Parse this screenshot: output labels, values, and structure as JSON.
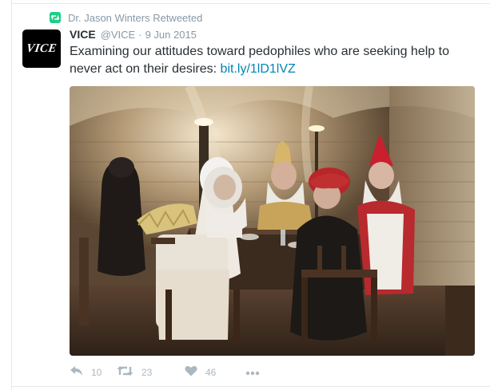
{
  "retweet_context": {
    "text": "Dr. Jason Winters Retweeted",
    "icon": "retweet-icon",
    "color": "#19cf86"
  },
  "tweet": {
    "avatar_text": "VICE",
    "fullname": "VICE",
    "username": "@VICE",
    "separator": "·",
    "timestamp": "9 Jun 2015",
    "text": "Examining our attitudes toward pedophiles who are seeking help to never act on their desires: ",
    "link": "bit.ly/1lD1lVZ",
    "link_color": "#0084b4",
    "media_icon": "photo-vaulted-cellar-costumed-people-at-table"
  },
  "actions": {
    "reply": {
      "icon": "reply-icon",
      "count": "10"
    },
    "retweet": {
      "icon": "retweet-icon",
      "count": "23"
    },
    "like": {
      "icon": "heart-icon",
      "count": "46"
    },
    "more": {
      "icon": "more-icon"
    }
  },
  "colors": {
    "text": "#292f33",
    "muted": "#8899a6",
    "action": "#aab8c2",
    "border": "#e1e8ed"
  }
}
